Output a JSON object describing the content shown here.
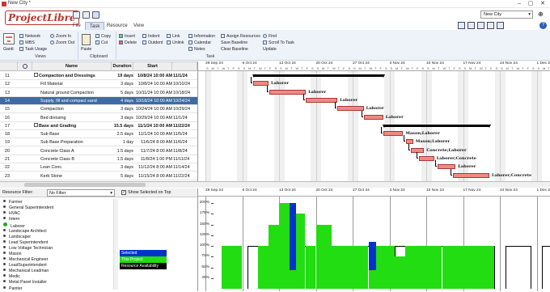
{
  "app": {
    "title": "New City *",
    "project_select": "New City",
    "logo": "ProjectLibre"
  },
  "tabs": [
    "File",
    "Task",
    "Resource",
    "View"
  ],
  "ribbon": {
    "views": {
      "group": "Views",
      "gantt": "Gantt",
      "network": "Network",
      "wbs": "WBS",
      "task_usage": "Task Usage",
      "zoom_in": "Zoom In",
      "zoom_out": "Zoom Out"
    },
    "clipboard": {
      "group": "Clipboard",
      "paste": "Paste",
      "copy": "Copy",
      "cut": "Cut"
    },
    "task": {
      "group": "Task",
      "insert": "Insert",
      "delete": "Delete",
      "indent": "Indent",
      "outdent": "Outdent",
      "link": "Link",
      "unlink": "Unlink",
      "information": "Information",
      "calendar": "Calendar",
      "notes": "Notes",
      "assign": "Assign Resources",
      "save_baseline": "Save Baseline",
      "clear_baseline": "Clear Baseline",
      "find": "Find",
      "scroll": "Scroll To Task",
      "update": "Update"
    }
  },
  "grid": {
    "headers": {
      "name": "Name",
      "duration": "Duration",
      "start": "Start"
    },
    "rows": [
      {
        "id": "11",
        "name": "Compaction and Dressings",
        "duration": "19 days",
        "start": "10/8/24 10:00 AM",
        "finish": "11/1/24",
        "summary": true
      },
      {
        "id": "12",
        "name": "Fill Material",
        "duration": "3 days",
        "start": "10/8/24 10:00 AM",
        "finish": "10/10/24"
      },
      {
        "id": "13",
        "name": "Natural ground Compaction",
        "duration": "5 days",
        "start": "10/11/24 10:00 AM",
        "finish": "10/18/24"
      },
      {
        "id": "14",
        "name": "Supply, fill and compact sand",
        "duration": "4 days",
        "start": "10/18/24 10:00 AM",
        "finish": "10/24/24",
        "selected": true
      },
      {
        "id": "15",
        "name": "Compaction",
        "duration": "3 days",
        "start": "10/24/24 10:00 AM",
        "finish": "10/29/24"
      },
      {
        "id": "16",
        "name": "Bed dressing",
        "duration": "3 days",
        "start": "10/29/24 10:00 AM",
        "finish": "11/1/24"
      },
      {
        "id": "17",
        "name": "Base and Grading",
        "duration": "15.5 days",
        "start": "11/1/24 10:00 AM",
        "finish": "11/22/24",
        "summary": true
      },
      {
        "id": "18",
        "name": "Sub Base",
        "duration": "2.5 days",
        "start": "11/1/24 10:00 AM",
        "finish": "11/5/24"
      },
      {
        "id": "19",
        "name": "Sub Base Preparation",
        "duration": "1 day",
        "start": "11/6/24 8:00 AM",
        "finish": "11/6/24"
      },
      {
        "id": "20",
        "name": "Concrete Class A",
        "duration": "1.5 days",
        "start": "11/7/24 8:00 AM",
        "finish": "11/8/24"
      },
      {
        "id": "21",
        "name": "Concrete Class B",
        "duration": "1.5 days",
        "start": "11/8/24 1:00 PM",
        "finish": "11/11/24"
      },
      {
        "id": "22",
        "name": "Lean Conc.",
        "duration": "3 days",
        "start": "11/12/24 8:00 AM",
        "finish": "11/14/24"
      },
      {
        "id": "23",
        "name": "Kerb Stone",
        "duration": "5 days",
        "start": "11/15/24 8:00 AM",
        "finish": "11/22/24"
      }
    ]
  },
  "gantt": {
    "top_dates": [
      "29 Sep 24",
      "6 Oct 24",
      "13 Oct 24",
      "20 Oct 24",
      "27 Oct 24",
      "3 Nov 24",
      "10 Nov 24",
      "17 Nov 24",
      "24 Nov 24",
      "1 Dec 24"
    ],
    "day_letters": "S M T W T F S",
    "labels": [
      "Laborer",
      "Laborer",
      "Laborer",
      "Laborer",
      "Laborer",
      "Mason;Laborer",
      "Mason;Laborer",
      "Concrete;Laborer",
      "Laborer;Concrete",
      "Laborer",
      "Laborer;Concrete"
    ]
  },
  "resources": {
    "filter_label": "Resource Filter:",
    "filter_value": "No Filter",
    "show_selected": "Show Selected on Top",
    "list": [
      "Farmer",
      "General Superintendent",
      "HVAC",
      "Intern",
      "Laborer",
      "Landscape Architect",
      "Landscaper",
      "Lead Superintendent",
      "Low Voltage Technician",
      "Mason",
      "Mechanical Engineer",
      "LeadSuperintendent",
      "Mechanical Leadman",
      "Medic",
      "Metal Panel Installer",
      "Painter"
    ],
    "legend": {
      "selected": "Selected",
      "this_project": "This Project",
      "availability": "Resource Availability"
    },
    "colors": {
      "selected": "#0033cc",
      "this_project": "#22dd11",
      "availability": "#000000"
    }
  },
  "histogram": {
    "percent_labels": [
      "200%",
      "175%",
      "150%",
      "125%",
      "100%",
      "75%",
      "50%",
      "25%"
    ]
  }
}
